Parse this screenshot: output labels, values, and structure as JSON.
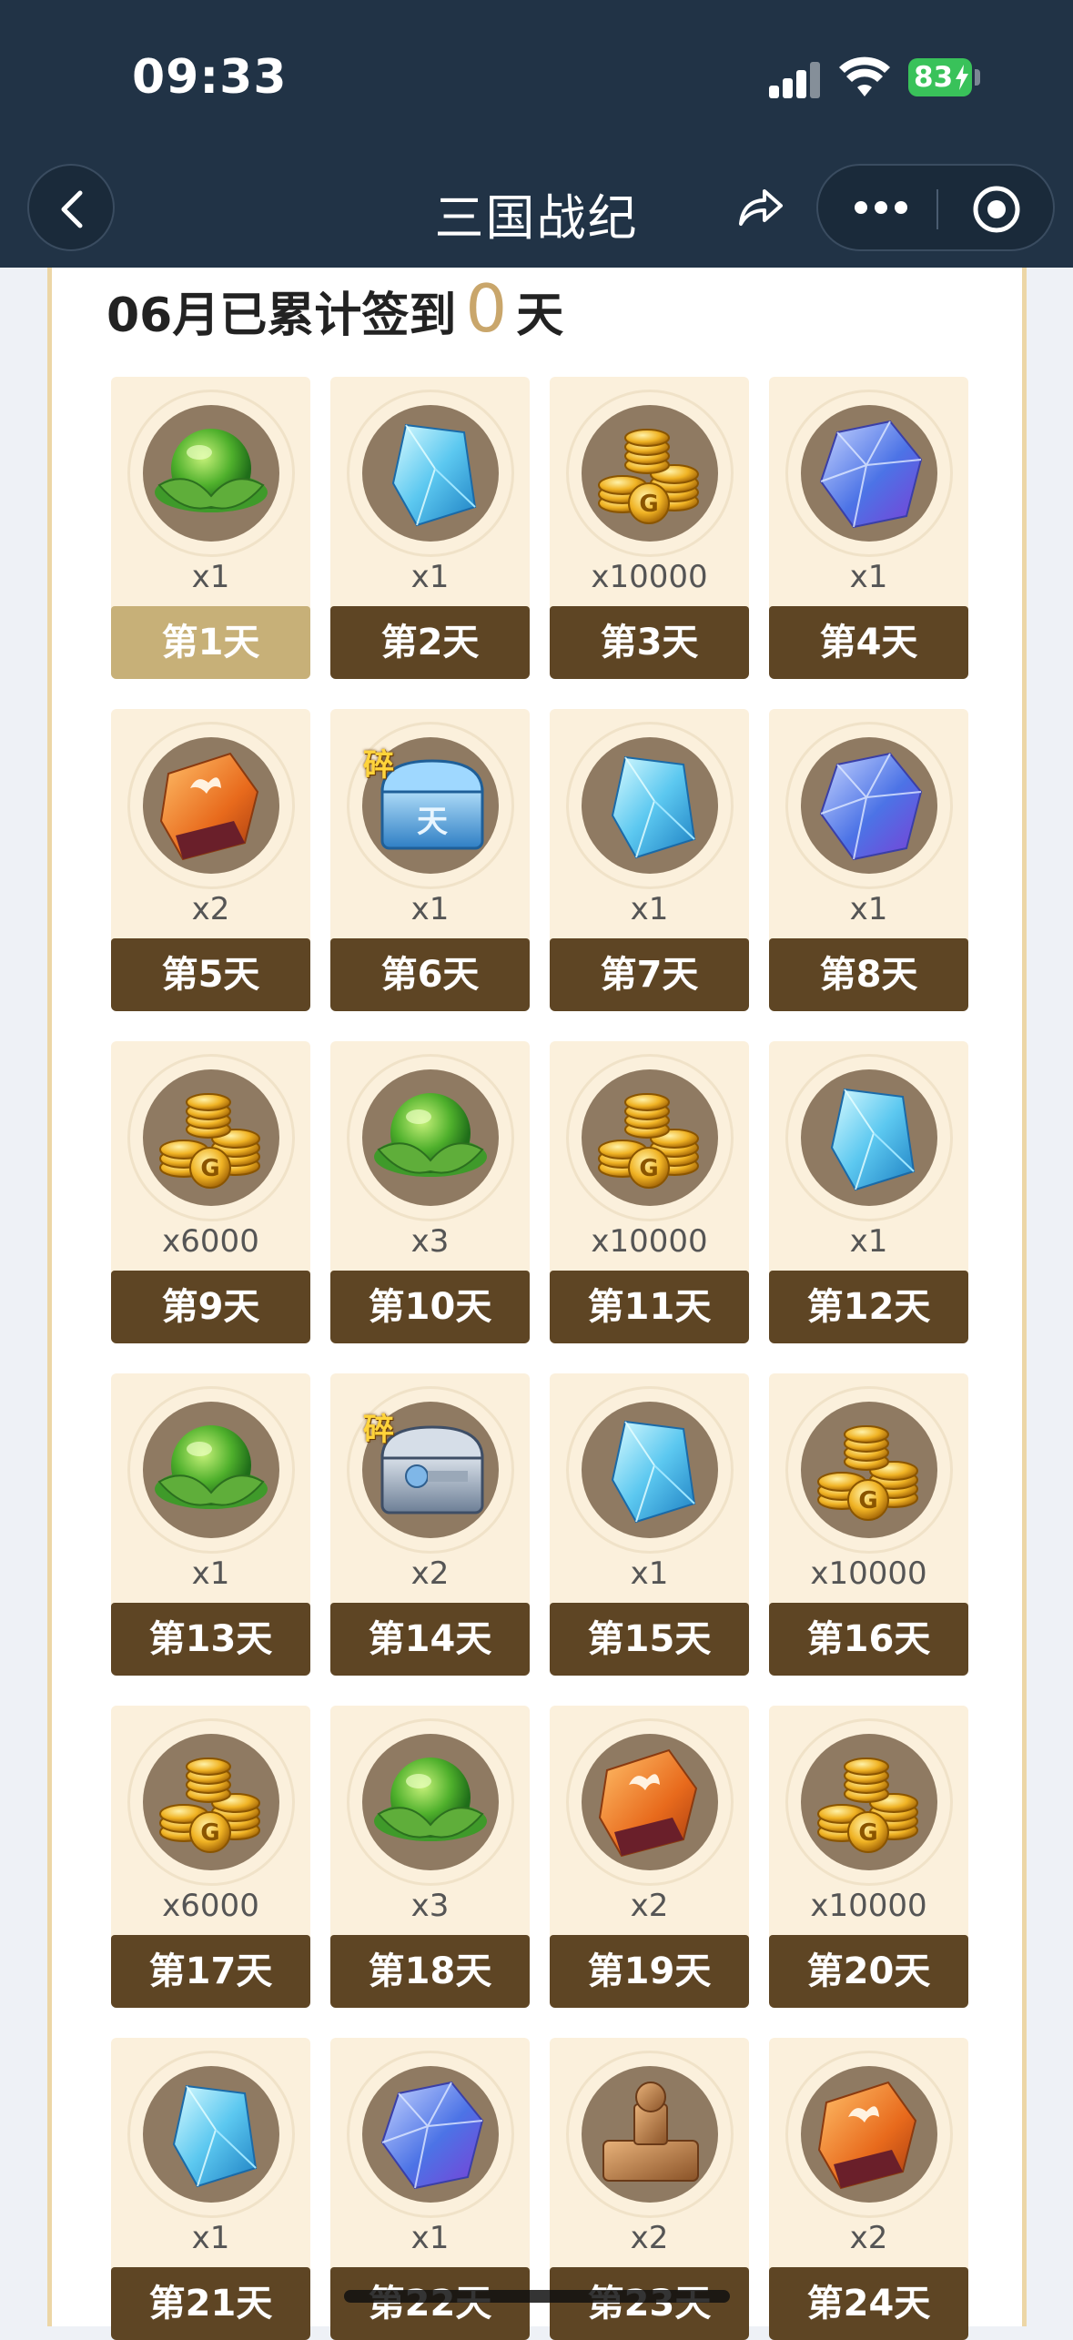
{
  "status_bar": {
    "time": "09:33",
    "battery": "83"
  },
  "nav": {
    "title": "三国战纪"
  },
  "signin": {
    "prefix": "06月已累计签到",
    "count": "0",
    "suffix": "天"
  },
  "rewards": [
    {
      "item": "green-orb",
      "qty": "x1",
      "day": "第1天",
      "active": true
    },
    {
      "item": "blue-crystal",
      "qty": "x1",
      "day": "第2天"
    },
    {
      "item": "gold-coins",
      "qty": "x10000",
      "day": "第3天"
    },
    {
      "item": "blue-gem",
      "qty": "x1",
      "day": "第4天"
    },
    {
      "item": "red-scroll",
      "qty": "x2",
      "day": "第5天"
    },
    {
      "item": "blue-chest-shard",
      "qty": "x1",
      "day": "第6天",
      "tag": "碎"
    },
    {
      "item": "blue-crystal",
      "qty": "x1",
      "day": "第7天"
    },
    {
      "item": "blue-gem",
      "qty": "x1",
      "day": "第8天"
    },
    {
      "item": "gold-coins",
      "qty": "x6000",
      "day": "第9天"
    },
    {
      "item": "green-orb",
      "qty": "x3",
      "day": "第10天"
    },
    {
      "item": "gold-coins",
      "qty": "x10000",
      "day": "第11天"
    },
    {
      "item": "blue-crystal",
      "qty": "x1",
      "day": "第12天"
    },
    {
      "item": "green-orb",
      "qty": "x1",
      "day": "第13天"
    },
    {
      "item": "silver-chest-shard",
      "qty": "x2",
      "day": "第14天",
      "tag": "碎"
    },
    {
      "item": "blue-crystal",
      "qty": "x1",
      "day": "第15天"
    },
    {
      "item": "gold-coins",
      "qty": "x10000",
      "day": "第16天"
    },
    {
      "item": "gold-coins",
      "qty": "x6000",
      "day": "第17天"
    },
    {
      "item": "green-orb",
      "qty": "x3",
      "day": "第18天"
    },
    {
      "item": "red-scroll",
      "qty": "x2",
      "day": "第19天"
    },
    {
      "item": "gold-coins",
      "qty": "x10000",
      "day": "第20天"
    },
    {
      "item": "blue-crystal",
      "qty": "x1",
      "day": "第21天"
    },
    {
      "item": "blue-gem",
      "qty": "x1",
      "day": "第22天"
    },
    {
      "item": "bronze-seal",
      "qty": "x2",
      "day": "第23天"
    },
    {
      "item": "red-scroll",
      "qty": "x2",
      "day": "第24天"
    }
  ]
}
